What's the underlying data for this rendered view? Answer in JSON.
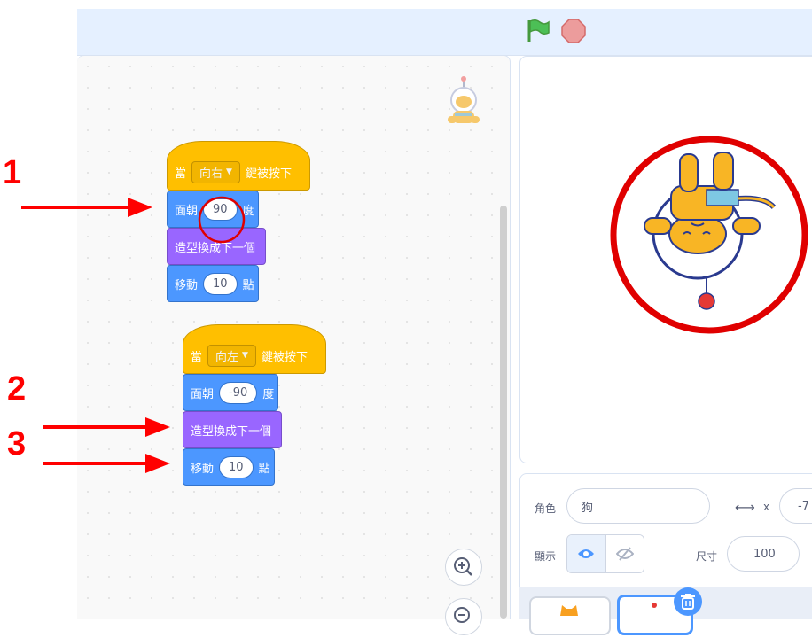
{
  "annotations": {
    "n1": "1",
    "n2": "2",
    "n3": "3"
  },
  "script1": {
    "hat": {
      "prefix": "當",
      "key": "向右",
      "suffix": "鍵被按下"
    },
    "point": {
      "label": "面朝",
      "value": "90",
      "unit": "度"
    },
    "costume": {
      "label": "造型換成下一個"
    },
    "move": {
      "label": "移動",
      "value": "10",
      "unit": "點"
    }
  },
  "script2": {
    "hat": {
      "prefix": "當",
      "key": "向左",
      "suffix": "鍵被按下"
    },
    "point": {
      "label": "面朝",
      "value": "-90",
      "unit": "度"
    },
    "costume": {
      "label": "造型換成下一個"
    },
    "move": {
      "label": "移動",
      "value": "10",
      "unit": "點"
    }
  },
  "sprite_info": {
    "sprite_label": "角色",
    "sprite_name": "狗",
    "x_label": "x",
    "x_value": "-7",
    "show_label": "顯示",
    "size_label": "尺寸",
    "size_value": "100"
  },
  "colors": {
    "events": "#ffbf00",
    "motion": "#4c97ff",
    "looks": "#9966ff",
    "annotation": "#ff0000"
  }
}
